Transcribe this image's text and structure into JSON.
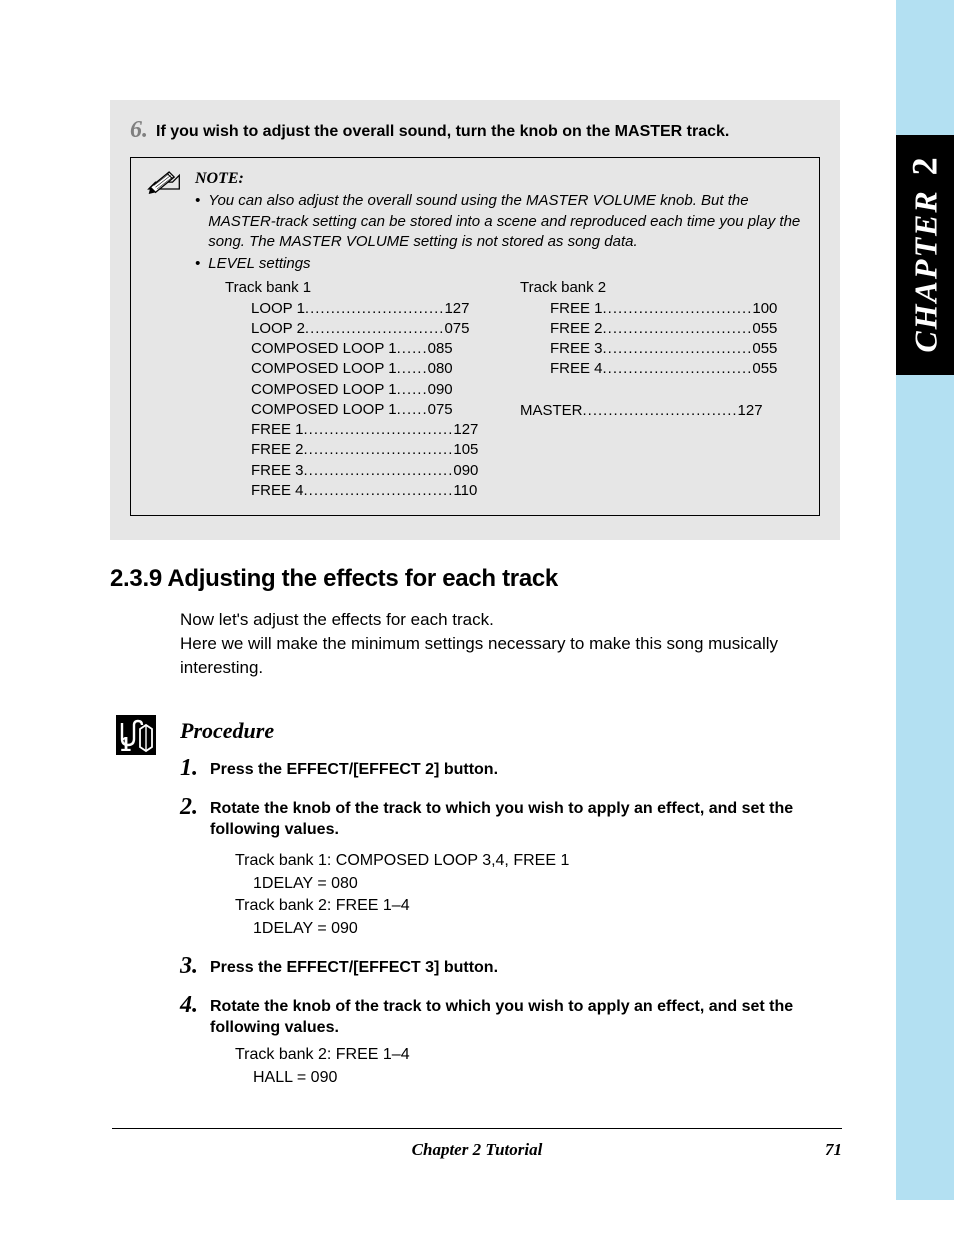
{
  "tab": {
    "word": "CHAPTER",
    "num": "2"
  },
  "box": {
    "step6_num": "6.",
    "step6_text": "If you wish to adjust the overall sound, turn the knob on the MASTER track.",
    "note_title": "NOTE:",
    "note_b1": "You can also adjust the overall sound using the MASTER VOLUME knob. But the MASTER-track setting can be stored into a scene and reproduced each time you play the song. The MASTER VOLUME setting is not stored as song data.",
    "note_b2": "LEVEL settings",
    "bank1_head": "Track bank 1",
    "bank2_head": "Track bank 2",
    "bank1": [
      {
        "label": "LOOP 1 ",
        "dots": "...........................",
        "val": "127"
      },
      {
        "label": "LOOP 2 ",
        "dots": "...........................",
        "val": "075"
      },
      {
        "label": "COMPOSED LOOP 1 ",
        "dots": "......",
        "val": "085"
      },
      {
        "label": "COMPOSED LOOP 1 ",
        "dots": "......",
        "val": "080"
      },
      {
        "label": "COMPOSED LOOP 1 ",
        "dots": "......",
        "val": "090"
      },
      {
        "label": "COMPOSED LOOP 1 ",
        "dots": "......",
        "val": "075"
      },
      {
        "label": "FREE 1 ",
        "dots": ".............................",
        "val": "127"
      },
      {
        "label": "FREE 2 ",
        "dots": ".............................",
        "val": "105"
      },
      {
        "label": "FREE 3 ",
        "dots": ".............................",
        "val": "090"
      },
      {
        "label": "FREE 4 ",
        "dots": ".............................",
        "val": "110"
      }
    ],
    "bank2": [
      {
        "label": "FREE 1 ",
        "dots": ".............................",
        "val": "100"
      },
      {
        "label": "FREE 2 ",
        "dots": ".............................",
        "val": "055"
      },
      {
        "label": "FREE 3 ",
        "dots": ".............................",
        "val": "055"
      },
      {
        "label": "FREE 4 ",
        "dots": ".............................",
        "val": "055"
      }
    ],
    "master": {
      "label": "MASTER",
      "dots": "..............................",
      "val": "127"
    }
  },
  "section": {
    "num_title": "2.3.9 Adjusting the effects for each track",
    "p1": "Now let's adjust the effects for each track.",
    "p2": "Here we will make the minimum settings necessary to make this song musically interesting."
  },
  "proc": {
    "head": "Procedure",
    "s1_num": "1.",
    "s1_text": "Press the EFFECT/[EFFECT 2] button.",
    "s2_num": "2.",
    "s2_text": "Rotate the knob of the track to which you wish to apply an effect, and set the following values.",
    "s2_l1": "Track bank 1: COMPOSED LOOP 3,4, FREE 1",
    "s2_l2": "1DELAY = 080",
    "s2_l3": "Track bank 2: FREE 1–4",
    "s2_l4": "1DELAY = 090",
    "s3_num": "3.",
    "s3_text": "Press the EFFECT/[EFFECT 3] button.",
    "s4_num": "4.",
    "s4_text": "Rotate the knob of the track to which you wish to apply an effect, and set the following values.",
    "s4_l1": "Track bank 2: FREE 1–4",
    "s4_l2": "HALL = 090"
  },
  "footer": {
    "center": "Chapter 2   Tutorial",
    "page": "71"
  }
}
